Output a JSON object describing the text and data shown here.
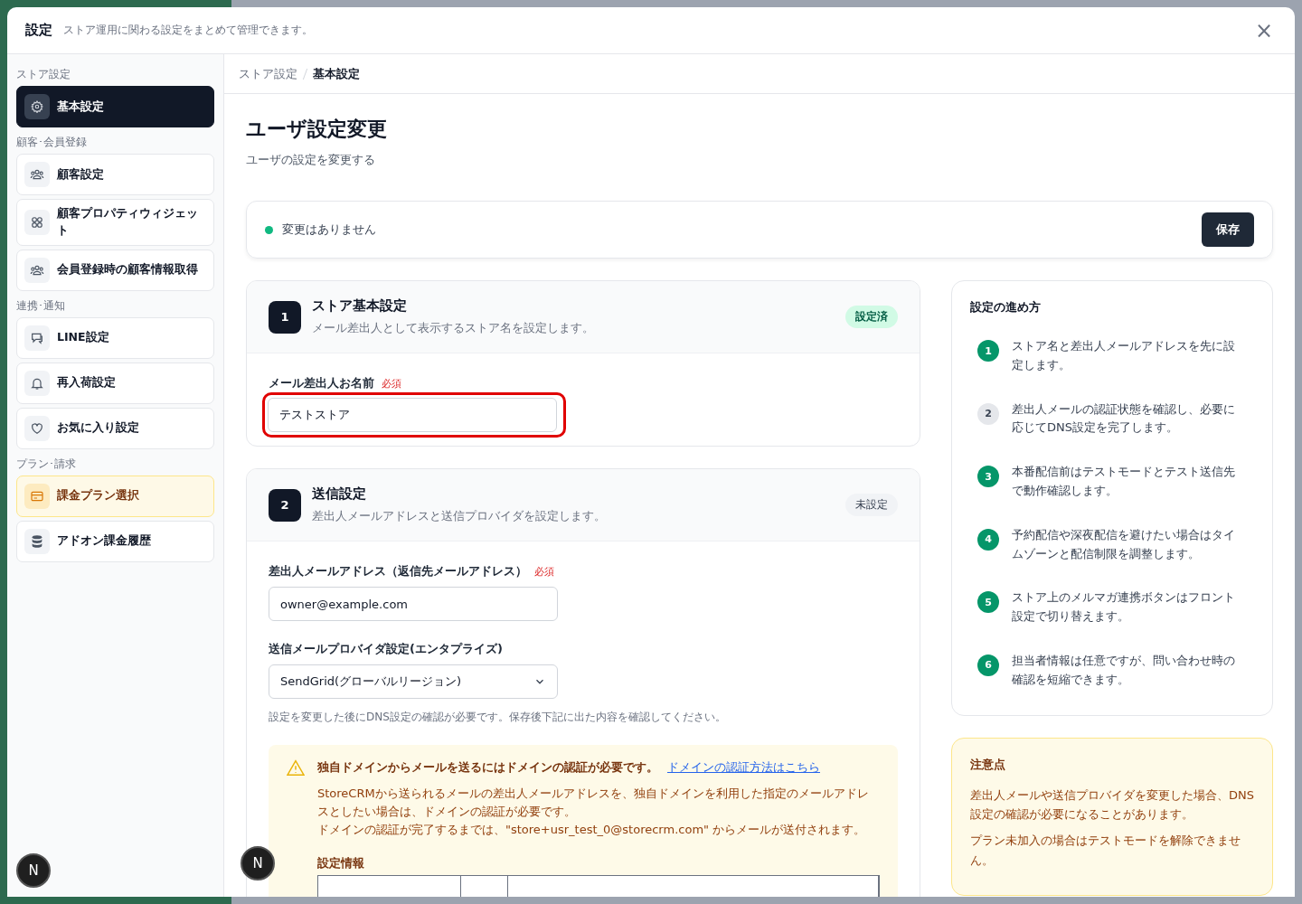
{
  "header": {
    "title": "設定",
    "subtitle": "ストア運用に関わる設定をまとめて管理できます。",
    "close": "×"
  },
  "sidebar": {
    "groups": [
      {
        "label": "ストア設定",
        "items": [
          {
            "label": "基本設定",
            "selected": true,
            "highlight": false
          }
        ]
      },
      {
        "label": "顧客･会員登録",
        "items": [
          {
            "label": "顧客設定",
            "selected": false,
            "highlight": false
          },
          {
            "label": "顧客プロパティウィジェット",
            "selected": false,
            "highlight": false
          },
          {
            "label": "会員登録時の顧客情報取得",
            "selected": false,
            "highlight": false
          }
        ]
      },
      {
        "label": "連携･通知",
        "items": [
          {
            "label": "LINE設定",
            "selected": false,
            "highlight": false
          },
          {
            "label": "再入荷設定",
            "selected": false,
            "highlight": false
          },
          {
            "label": "お気に入り設定",
            "selected": false,
            "highlight": false
          }
        ]
      },
      {
        "label": "プラン･請求",
        "items": [
          {
            "label": "課金プラン選択",
            "selected": false,
            "highlight": true
          },
          {
            "label": "アドオン課金履歴",
            "selected": false,
            "highlight": false
          }
        ]
      }
    ]
  },
  "breadcrumb": [
    {
      "label": "ストア設定",
      "selected": false
    },
    {
      "label": "基本設定",
      "selected": true
    }
  ],
  "page": {
    "title": "ユーザ設定変更",
    "subtitle": "ユーザの設定を変更する"
  },
  "status_bar": {
    "message": "変更はありません",
    "color": "#10b981",
    "save": "保存"
  },
  "sections": [
    {
      "number": "1",
      "title": "ストア基本設定",
      "description": "メール差出人として表示するストア名を設定します。",
      "badge": "設定済",
      "done": true,
      "fields": [
        {
          "kind": "text",
          "label": "メール差出人お名前",
          "required": "必須",
          "value": "テストストア",
          "highlighted": true
        }
      ]
    },
    {
      "number": "2",
      "title": "送信設定",
      "description": "差出人メールアドレスと送信プロバイダを設定します。",
      "badge": "未設定",
      "done": false,
      "fields": [
        {
          "kind": "text",
          "label": "差出人メールアドレス（返信先メールアドレス）",
          "required": "必須",
          "value": "owner@example.com",
          "highlighted": false
        },
        {
          "kind": "select",
          "label": "送信メールプロバイダ設定(エンタプライズ)",
          "value": "SendGrid(グローバルリージョン)",
          "help": "設定を変更した後にDNS設定の確認が必要です。保存後下記に出た内容を確認してください。",
          "highlighted": false
        }
      ],
      "alert": {
        "title": "独自ドメインからメールを送るにはドメインの認証が必要です。",
        "link": "ドメインの認証方法はこちら",
        "lines": [
          "StoreCRMから送られるメールの差出人メールアドレスを、独自ドメインを利用した指定のメールアドレスとしたい場合は、ドメインの認証が必要です。",
          "ドメインの認証が完了するまでは、\"store+usr_test_0@storecrm.com\" からメールが送付されます。"
        ],
        "table_title": "設定情報"
      }
    }
  ],
  "guide": {
    "title": "設定の進め方",
    "steps": [
      {
        "number": "1",
        "text": "ストア名と差出人メールアドレスを先に設定します。",
        "done": true
      },
      {
        "number": "2",
        "text": "差出人メールの認証状態を確認し、必要に応じてDNS設定を完了します。",
        "done": false
      },
      {
        "number": "3",
        "text": "本番配信前はテストモードとテスト送信先で動作確認します。",
        "done": true
      },
      {
        "number": "4",
        "text": "予約配信や深夜配信を避けたい場合はタイムゾーンと配信制限を調整します。",
        "done": true
      },
      {
        "number": "5",
        "text": "ストア上のメルマガ連携ボタンはフロント設定で切り替えます。",
        "done": true
      },
      {
        "number": "6",
        "text": "担当者情報は任意ですが、問い合わせ時の確認を短縮できます。",
        "done": true
      }
    ]
  },
  "notes": {
    "title": "注意点",
    "lines": [
      "差出人メールや送信プロバイダを変更した場合、DNS設定の確認が必要になることがあります。",
      "プラン未加入の場合はテストモードを解除できません。"
    ]
  },
  "dev_buttons": [
    "N",
    "N"
  ]
}
